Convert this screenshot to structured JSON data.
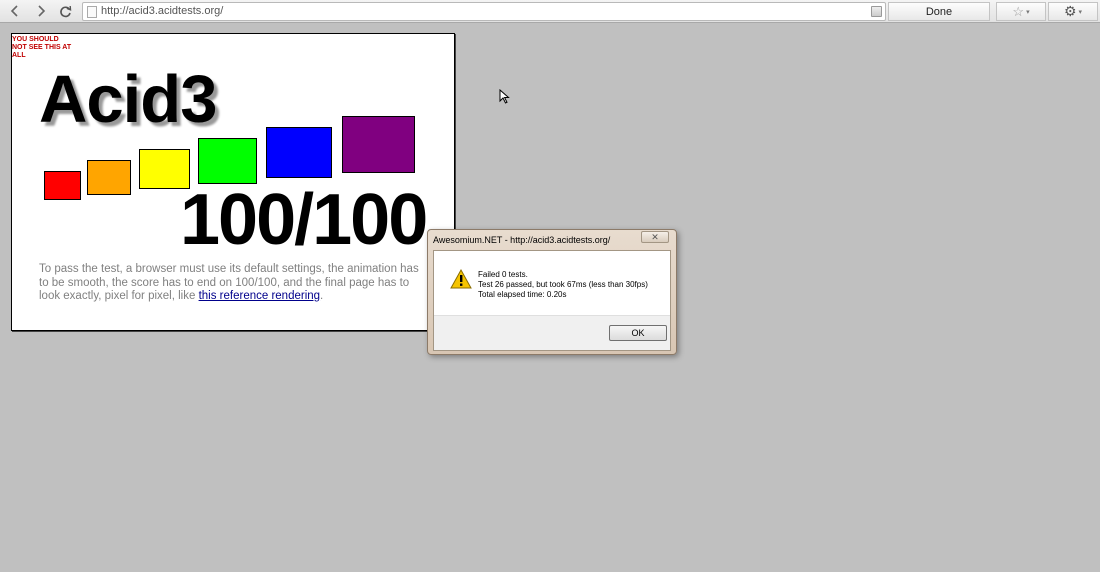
{
  "toolbar": {
    "back_icon": "chevron-left-icon",
    "forward_icon": "chevron-right-icon",
    "reload_icon": "reload-icon",
    "url": "http://acid3.acidtests.org/",
    "status": "Done",
    "star_icon": "☆",
    "gear_icon": "⚙",
    "dropdown_arrow": "▾"
  },
  "acid_page": {
    "warning": "YOU SHOULD NOT SEE THIS AT ALL",
    "title": "Acid3",
    "score": "100/100",
    "description_before": "To pass the test, a browser must use its default settings, the animation has to be smooth, the score has to end on 100/100, and the final page has to look exactly, pixel for pixel, like ",
    "description_link": "this reference rendering",
    "description_after": ".",
    "box_colors": [
      "#ff0000",
      "#ffa500",
      "#ffff00",
      "#00ff00",
      "#0000ff",
      "#800080"
    ]
  },
  "dialog": {
    "title": "Awesomium.NET - http://acid3.acidtests.org/",
    "close_label": "✕",
    "messages": [
      "Failed 0 tests.",
      "Test 26 passed, but took 67ms (less than 30fps)",
      "Total elapsed time: 0.20s"
    ],
    "ok_label": "OK"
  }
}
